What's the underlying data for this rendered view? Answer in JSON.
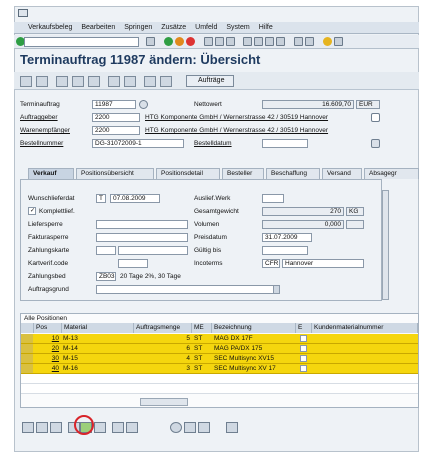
{
  "menu": [
    "Verkaufsbeleg",
    "Bearbeiten",
    "Springen",
    "Zusätze",
    "Umfeld",
    "System",
    "Hilfe"
  ],
  "title": "Terminauftrag 11987 ändern: Übersicht",
  "app_toolbar": {
    "auftraege_label": "Aufträge"
  },
  "header": {
    "terminauftrag_label": "Terminauftrag",
    "terminauftrag_value": "11987",
    "nettowert_label": "Nettowert",
    "nettowert_value": "16.609,70",
    "currency": "EUR",
    "auftraggeber_label": "Auftraggeber",
    "auftraggeber_value": "2200",
    "auftraggeber_name": "HTG Komponente GmbH / Wernerstrasse 42 / 30519 Hannover",
    "warenempfaenger_label": "Warenempfänger",
    "warenempfaenger_value": "2200",
    "warenempfaenger_name": "HTG Komponente GmbH / Wernerstrasse 42 / 30519 Hannover",
    "bestellnummer_label": "Bestellnummer",
    "bestellnummer_value": "DG-31072009-1",
    "bestelldatum_label": "Bestelldatum",
    "bestelldatum_value": ""
  },
  "tabs": [
    "Verkauf",
    "Positionsübersicht",
    "Positionsdetail",
    "Besteller",
    "Beschaffung",
    "Versand",
    "Absagegr"
  ],
  "verkauf": {
    "wunschlieferdat_label": "Wunschlieferdat",
    "wunschlieferdat_type": "T",
    "wunschlieferdat_value": "07.08.2009",
    "auslieferwerk_label": "Auslief.Werk",
    "auslieferwerk_value": "",
    "komplettlief_label": "Komplettlief.",
    "komplettlief_checked": "✓",
    "gesamtgewicht_label": "Gesamtgewicht",
    "gesamtgewicht_value": "270",
    "gewicht_unit": "KG",
    "liefersperre_label": "Liefersperre",
    "volumen_label": "Volumen",
    "volumen_value": "0,000",
    "fakturasperre_label": "Fakturasperre",
    "preisdatum_label": "Preisdatum",
    "preisdatum_value": "31.07.2009",
    "zahlungskarte_label": "Zahlungskarte",
    "gueltig_bis_label": "Gültig bis",
    "kartverifcode_label": "Kartverif.code",
    "incoterms_label": "Incoterms",
    "incoterms_code": "CFR",
    "incoterms_place": "Hannover",
    "zahlungsbed_label": "Zahlungsbed",
    "zahlungsbed_code": "ZB03",
    "zahlungsbed_text": "20 Tage 2%, 30 Tage",
    "auftragsgrund_label": "Auftragsgrund"
  },
  "table": {
    "section_label": "Alle Positionen",
    "columns": [
      "Pos",
      "Material",
      "Auftragsmenge",
      "ME",
      "Bezeichnung",
      "E",
      "Kundenmaterialnummer"
    ],
    "rows": [
      {
        "pos": "10",
        "material": "M-13",
        "menge": "5",
        "me": "ST",
        "bez": "MAG DX 17F"
      },
      {
        "pos": "20",
        "material": "M-14",
        "menge": "6",
        "me": "ST",
        "bez": "MAG PA/DX 175"
      },
      {
        "pos": "30",
        "material": "M-15",
        "menge": "4",
        "me": "ST",
        "bez": "SEC Multisync XV15"
      },
      {
        "pos": "40",
        "material": "M-16",
        "menge": "3",
        "me": "ST",
        "bez": "SEC Multisync XV 17"
      }
    ]
  },
  "colors": {
    "highlight_row": "#f5d60e",
    "title_text": "#1e3a5f",
    "circle": "#d8242a"
  }
}
